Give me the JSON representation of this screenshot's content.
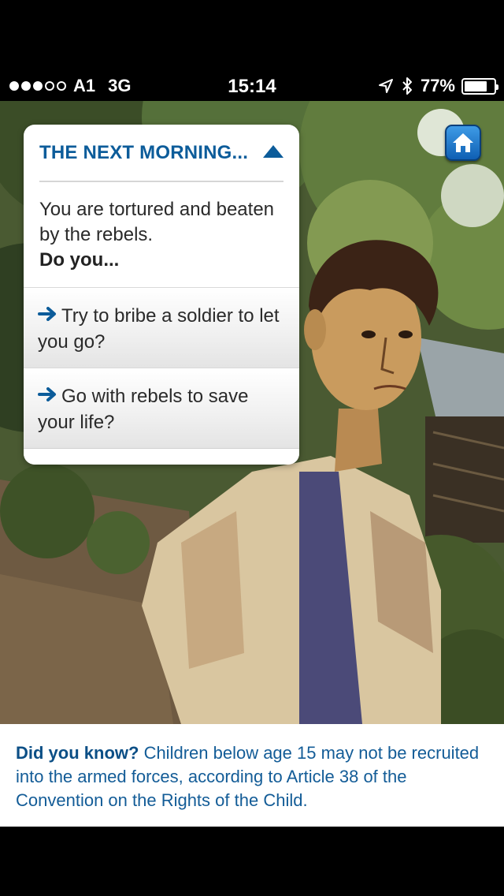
{
  "status_bar": {
    "carrier": "A1",
    "network": "3G",
    "time": "15:14",
    "battery_percent": "77%",
    "battery_level": 0.77,
    "signal_bars_filled": 3,
    "signal_bars_total": 5,
    "icons": [
      "location-arrow-icon",
      "bluetooth-icon",
      "battery-icon"
    ]
  },
  "home_button": {
    "icon": "home-icon",
    "color": "#1a73c9"
  },
  "card": {
    "title": "THE NEXT MORNING...",
    "collapse_icon": "triangle-up-icon",
    "story_text": "You are tortured and beaten by the rebels.",
    "prompt": "Do you...",
    "options": [
      {
        "label": "Try to bribe a soldier to let you go?",
        "icon": "arrow-right-icon"
      },
      {
        "label": "Go with rebels to save your life?",
        "icon": "arrow-right-icon"
      }
    ]
  },
  "info": {
    "heading": "Did you know?",
    "text": "Children below age 15 may not be recruited into the armed forces, according to Article 38 of the Convention on the Rights of the Child."
  },
  "colors": {
    "accent": "#0c5c9a",
    "info_text": "#135c97",
    "home_button": "#1a73c9"
  }
}
